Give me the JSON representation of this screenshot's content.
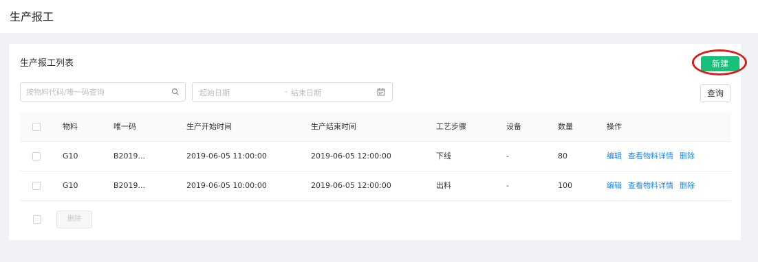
{
  "page": {
    "title": "生产报工"
  },
  "card": {
    "title": "生产报工列表",
    "new_label": "新建"
  },
  "filters": {
    "search_placeholder": "按物料代码/唯一码查询",
    "date_start_placeholder": "起始日期",
    "date_separator": "-",
    "date_end_placeholder": "结束日期",
    "query_label": "查询"
  },
  "table": {
    "headers": {
      "material": "物料",
      "code": "唯一码",
      "start_time": "生产开始时间",
      "end_time": "生产结束时间",
      "step": "工艺步骤",
      "device": "设备",
      "qty": "数量",
      "ops": "操作"
    },
    "rows": [
      {
        "material": "G10",
        "code": "B2019...",
        "start_time": "2019-06-05 11:00:00",
        "end_time": "2019-06-05 12:00:00",
        "step": "下线",
        "device": "-",
        "qty": "80",
        "ops": {
          "edit": "编辑",
          "detail": "查看物料详情",
          "delete": "删除"
        }
      },
      {
        "material": "G10",
        "code": "B2019...",
        "start_time": "2019-06-05 10:00:00",
        "end_time": "2019-06-05 12:00:00",
        "step": "出料",
        "device": "-",
        "qty": "100",
        "ops": {
          "edit": "编辑",
          "detail": "查看物料详情",
          "delete": "删除"
        }
      }
    ]
  },
  "footer": {
    "batch_delete_label": "删除"
  },
  "colors": {
    "primary": "#18c07a",
    "link": "#1e88e5",
    "annotation": "#d21f1f"
  },
  "icons": {
    "search": "search-icon",
    "calendar": "calendar-icon"
  }
}
